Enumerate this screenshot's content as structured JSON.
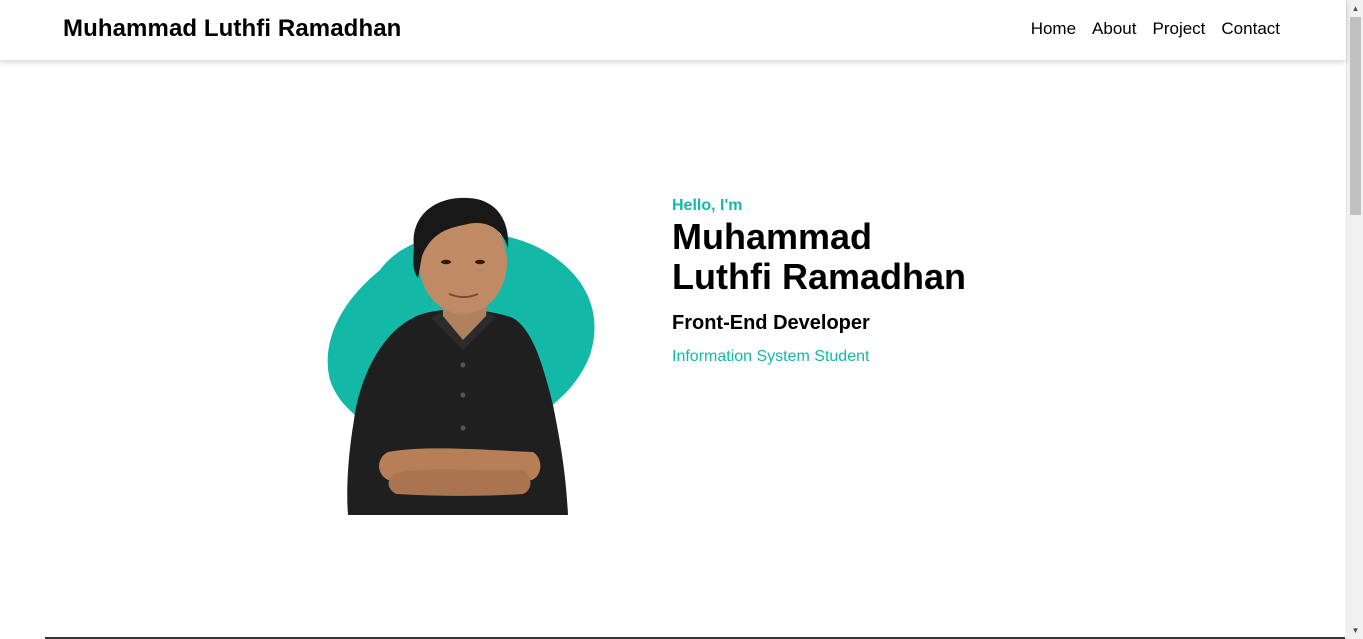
{
  "navbar": {
    "brand": "Muhammad Luthfi Ramadhan",
    "links": [
      "Home",
      "About",
      "Project",
      "Contact"
    ]
  },
  "hero": {
    "greeting": "Hello, I'm",
    "name_line1": "Muhammad",
    "name_line2": "Luthfi Ramadhan",
    "role": "Front-End Developer",
    "subrole": "Information System Student",
    "photo_icon": "person-portrait-icon"
  },
  "colors": {
    "accent": "#14b8a6",
    "text": "#000000",
    "background": "#ffffff"
  }
}
